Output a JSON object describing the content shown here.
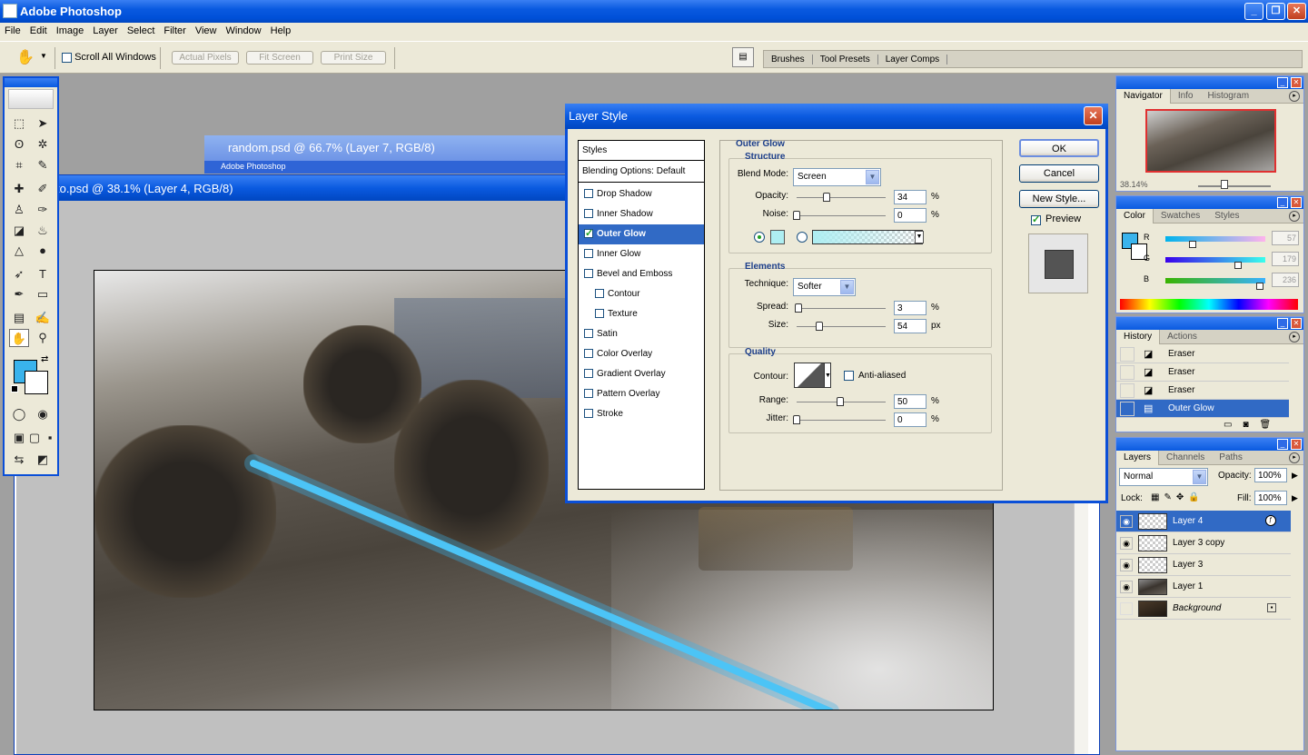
{
  "window": {
    "title": "Adobe Photoshop"
  },
  "menu": [
    "File",
    "Edit",
    "Image",
    "Layer",
    "Select",
    "Filter",
    "View",
    "Window",
    "Help"
  ],
  "options_bar": {
    "scroll_all": "Scroll All Windows",
    "actual_pixels": "Actual Pixels",
    "fit_screen": "Fit Screen",
    "print_size": "Print Size"
  },
  "palette_well": [
    "Brushes",
    "Tool Presets",
    "Layer Comps"
  ],
  "documents": {
    "back": {
      "title": "random.psd @ 66.7% (Layer 7, RGB/8)",
      "subtitle": "Adobe Photoshop"
    },
    "front": {
      "title": "to.psd @ 38.1% (Layer 4, RGB/8)"
    }
  },
  "colors": {
    "foreground": "#39b3ec",
    "background": "#ffffff",
    "glow": "#aeeef2",
    "selection": "#316ac5"
  },
  "navigator": {
    "tabs": [
      "Navigator",
      "Info",
      "Histogram"
    ],
    "zoom": "38.14%"
  },
  "color_panel": {
    "tabs": [
      "Color",
      "Swatches",
      "Styles"
    ],
    "r_label": "R",
    "r": "57",
    "g_label": "G",
    "g": "179",
    "b_label": "B",
    "b": "236"
  },
  "history": {
    "tabs": [
      "History",
      "Actions"
    ],
    "items": [
      "Eraser",
      "Eraser",
      "Eraser",
      "Outer Glow"
    ]
  },
  "layers_panel": {
    "tabs": [
      "Layers",
      "Channels",
      "Paths"
    ],
    "blend": "Normal",
    "opacity_label": "Opacity:",
    "opacity": "100%",
    "lock_label": "Lock:",
    "fill_label": "Fill:",
    "fill": "100%",
    "layers": [
      "Layer 4",
      "Layer 3 copy",
      "Layer 3",
      "Layer 1",
      "Background"
    ]
  },
  "dialog": {
    "title": "Layer Style",
    "styles_header": "Styles",
    "blending": "Blending Options: Default",
    "styles": [
      "Drop Shadow",
      "Inner Shadow",
      "Outer Glow",
      "Inner Glow",
      "Bevel and Emboss",
      "Contour",
      "Texture",
      "Satin",
      "Color Overlay",
      "Gradient Overlay",
      "Pattern Overlay",
      "Stroke"
    ],
    "section_title": "Outer Glow",
    "structure": {
      "title": "Structure",
      "blend_mode_label": "Blend Mode:",
      "blend_mode": "Screen",
      "opacity_label": "Opacity:",
      "opacity": "34",
      "noise_label": "Noise:",
      "noise": "0",
      "percent": "%"
    },
    "elements": {
      "title": "Elements",
      "technique_label": "Technique:",
      "technique": "Softer",
      "spread_label": "Spread:",
      "spread": "3",
      "size_label": "Size:",
      "size": "54",
      "percent": "%",
      "px": "px"
    },
    "quality": {
      "title": "Quality",
      "contour_label": "Contour:",
      "antialiased": "Anti-aliased",
      "range_label": "Range:",
      "range": "50",
      "jitter_label": "Jitter:",
      "jitter": "0",
      "percent": "%"
    },
    "buttons": {
      "ok": "OK",
      "cancel": "Cancel",
      "new_style": "New Style..."
    },
    "preview_label": "Preview"
  }
}
